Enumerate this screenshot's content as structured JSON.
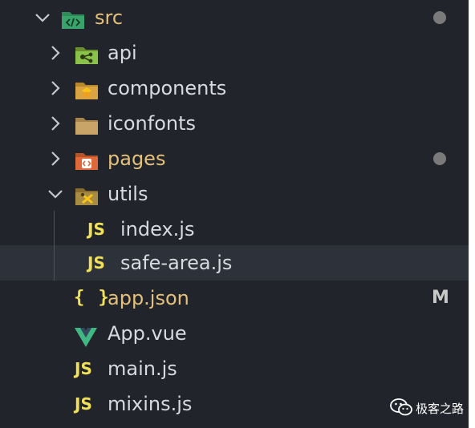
{
  "explorer": {
    "root": {
      "label": "src",
      "icon": "folder-src-icon",
      "status_dot": true
    },
    "folders": [
      {
        "label": "api",
        "icon": "folder-api-icon"
      },
      {
        "label": "components",
        "icon": "folder-components-icon"
      },
      {
        "label": "iconfonts",
        "icon": "folder-icon"
      },
      {
        "label": "pages",
        "icon": "folder-pages-icon",
        "status_dot": true
      },
      {
        "label": "utils",
        "icon": "folder-utils-icon"
      }
    ],
    "utils_children": [
      {
        "badge": "JS",
        "label": "index.js"
      },
      {
        "badge": "JS",
        "label": "safe-area.js",
        "selected": true
      }
    ],
    "files": [
      {
        "badge": "{ }",
        "label": "app.json",
        "status": "M"
      },
      {
        "badge": "",
        "label": "App.vue",
        "icon": "vue-icon"
      },
      {
        "badge": "JS",
        "label": "main.js"
      },
      {
        "badge": "JS",
        "label": "mixins.js"
      }
    ]
  },
  "watermark": {
    "text": "极客之路",
    "icon": "wechat-icon"
  },
  "colors": {
    "background": "#21252b",
    "selected_row": "#2c313a",
    "text": "#d7dae0",
    "modified_text": "#e5c07b",
    "js_badge": "#f1e05a"
  }
}
